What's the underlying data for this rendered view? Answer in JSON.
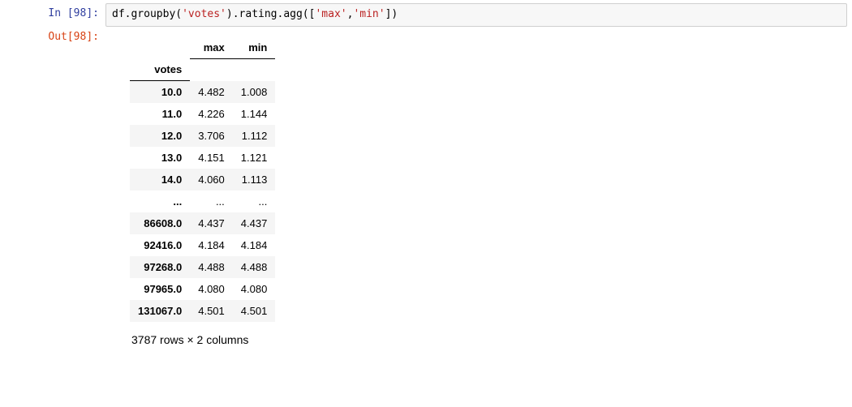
{
  "in_prompt": "In [98]:",
  "out_prompt": "Out[98]:",
  "code": {
    "pre1": "df.groupby(",
    "str1": "'votes'",
    "mid1": ").rating.agg([",
    "str2": "'max'",
    "comma": ",",
    "str3": "'min'",
    "post": "])"
  },
  "table": {
    "index_name": "votes",
    "columns": [
      "max",
      "min"
    ],
    "rows": [
      {
        "idx": "10.0",
        "max": "4.482",
        "min": "1.008"
      },
      {
        "idx": "11.0",
        "max": "4.226",
        "min": "1.144"
      },
      {
        "idx": "12.0",
        "max": "3.706",
        "min": "1.112"
      },
      {
        "idx": "13.0",
        "max": "4.151",
        "min": "1.121"
      },
      {
        "idx": "14.0",
        "max": "4.060",
        "min": "1.113"
      },
      {
        "idx": "...",
        "max": "...",
        "min": "..."
      },
      {
        "idx": "86608.0",
        "max": "4.437",
        "min": "4.437"
      },
      {
        "idx": "92416.0",
        "max": "4.184",
        "min": "4.184"
      },
      {
        "idx": "97268.0",
        "max": "4.488",
        "min": "4.488"
      },
      {
        "idx": "97965.0",
        "max": "4.080",
        "min": "4.080"
      },
      {
        "idx": "131067.0",
        "max": "4.501",
        "min": "4.501"
      }
    ],
    "shape_text": "3787 rows × 2 columns"
  }
}
